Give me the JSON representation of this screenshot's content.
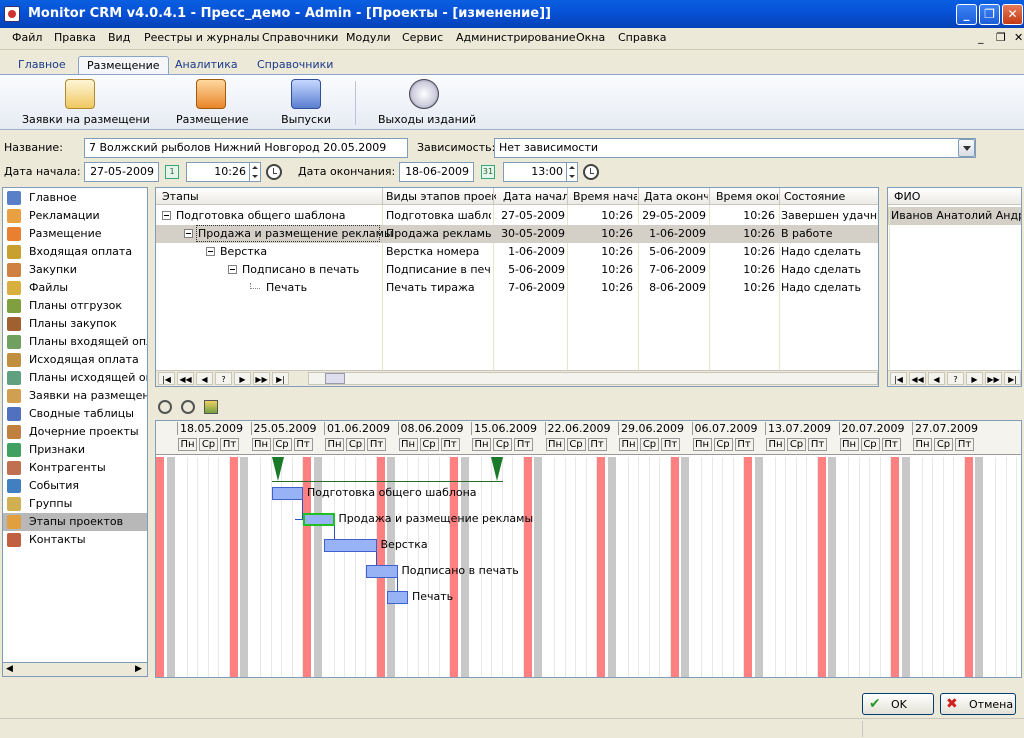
{
  "window": {
    "title": "Monitor CRM v4.0.4.1 - Пресс_демо - Admin - [Проекты - [изменение]]"
  },
  "menu": [
    "Файл",
    "Правка",
    "Вид",
    "Реестры и журналы",
    "Справочники",
    "Модули",
    "Сервис",
    "Администрирование",
    "Окна",
    "Справка"
  ],
  "ribbon": {
    "tabs": [
      "Главное",
      "Размещение",
      "Аналитика",
      "Справочники"
    ],
    "active_tab": "Размещение",
    "buttons": [
      {
        "label": "Заявки на размещени",
        "icon": "order-pencil-icon"
      },
      {
        "label": "Размещение",
        "icon": "truck-icon"
      },
      {
        "label": "Выпуски",
        "icon": "books-icon"
      },
      {
        "label": "Выходы изданий",
        "icon": "stopwatch-icon"
      }
    ]
  },
  "form": {
    "name_label": "Название:",
    "name_value": "7 Волжский рыболов Нижний Новгород 20.05.2009",
    "dependency_label": "Зависимость:",
    "dependency_value": "Нет зависимости",
    "start_label": "Дата начала:",
    "start_date": "27-05-2009",
    "start_time": "10:26",
    "end_label": "Дата окончания:",
    "end_date": "18-06-2009",
    "end_time": "13:00",
    "cal_start": "1",
    "cal_end": "31"
  },
  "sidebar": [
    {
      "label": "Главное",
      "color": "#5a7fc9"
    },
    {
      "label": "Рекламации",
      "color": "#e8a040"
    },
    {
      "label": "Размещение",
      "color": "#e88030"
    },
    {
      "label": "Входящая оплата",
      "color": "#c8a030"
    },
    {
      "label": "Закупки",
      "color": "#d08040"
    },
    {
      "label": "Файлы",
      "color": "#d8b040"
    },
    {
      "label": "Планы отгрузок",
      "color": "#80a040"
    },
    {
      "label": "Планы закупок",
      "color": "#a06030"
    },
    {
      "label": "Планы входящей оплаты",
      "color": "#70a060"
    },
    {
      "label": "Исходящая оплата",
      "color": "#c09040"
    },
    {
      "label": "Планы исходящей оплаты",
      "color": "#60a080"
    },
    {
      "label": "Заявки на размещение",
      "color": "#d0a050"
    },
    {
      "label": "Сводные таблицы",
      "color": "#5070c0"
    },
    {
      "label": "Дочерние проекты",
      "color": "#c08040"
    },
    {
      "label": "Признаки",
      "color": "#40a060"
    },
    {
      "label": "Контрагенты",
      "color": "#c07050"
    },
    {
      "label": "События",
      "color": "#4080c0"
    },
    {
      "label": "Группы",
      "color": "#d0b050"
    },
    {
      "label": "Этапы проектов",
      "color": "#e0a040"
    },
    {
      "label": "Контакты",
      "color": "#c06040"
    }
  ],
  "sidebar_selected": 18,
  "stages": {
    "columns": [
      "Этапы",
      "Виды этапов проект",
      "Дата начала",
      "Время нача.",
      "Дата оконча",
      "Время окон",
      "Состояние"
    ],
    "rows": [
      {
        "name": "Подготовка общего шаблона",
        "type": "Подготовка шаблона",
        "start_date": "27-05-2009",
        "start_time": "10:26",
        "end_date": "29-05-2009",
        "end_time": "10:26",
        "status": "Завершен удачно"
      },
      {
        "name": "Продажа и размещение рекламы",
        "type": "Продажа рекламы",
        "start_date": "30-05-2009",
        "start_time": "10:26",
        "end_date": "1-06-2009",
        "end_time": "10:26",
        "status": "В работе"
      },
      {
        "name": "Верстка",
        "type": "Верстка номера",
        "start_date": "1-06-2009",
        "start_time": "10:26",
        "end_date": "5-06-2009",
        "end_time": "10:26",
        "status": "Надо сделать"
      },
      {
        "name": "Подписано в печать",
        "type": "Подписание в печать",
        "start_date": "5-06-2009",
        "start_time": "10:26",
        "end_date": "7-06-2009",
        "end_time": "10:26",
        "status": "Надо сделать"
      },
      {
        "name": "Печать",
        "type": "Печать тиража",
        "start_date": "7-06-2009",
        "start_time": "10:26",
        "end_date": "8-06-2009",
        "end_time": "10:26",
        "status": "Надо сделать"
      }
    ]
  },
  "people": {
    "column": "ФИО",
    "rows": [
      "Иванов Анатолий Андреевич"
    ]
  },
  "nav_glyphs": [
    "|◀",
    "◀◀",
    "◀",
    "?",
    "▶",
    "▶▶",
    "▶|"
  ],
  "gantt": {
    "weeks": [
      "18.05.2009",
      "25.05.2009",
      "01.06.2009",
      "08.06.2009",
      "15.06.2009",
      "22.06.2009",
      "29.06.2009",
      "06.07.2009",
      "13.07.2009",
      "20.07.2009",
      "27.07.2009"
    ],
    "day_labels": [
      "Пн",
      "Ср",
      "Пт"
    ],
    "tasks": [
      "Подготовка общего шаблона",
      "Продажа и размещение рекламы",
      "Верстка",
      "Подписано в печать",
      "Печать"
    ]
  },
  "buttons": {
    "ok": "OK",
    "cancel": "Отмена"
  }
}
